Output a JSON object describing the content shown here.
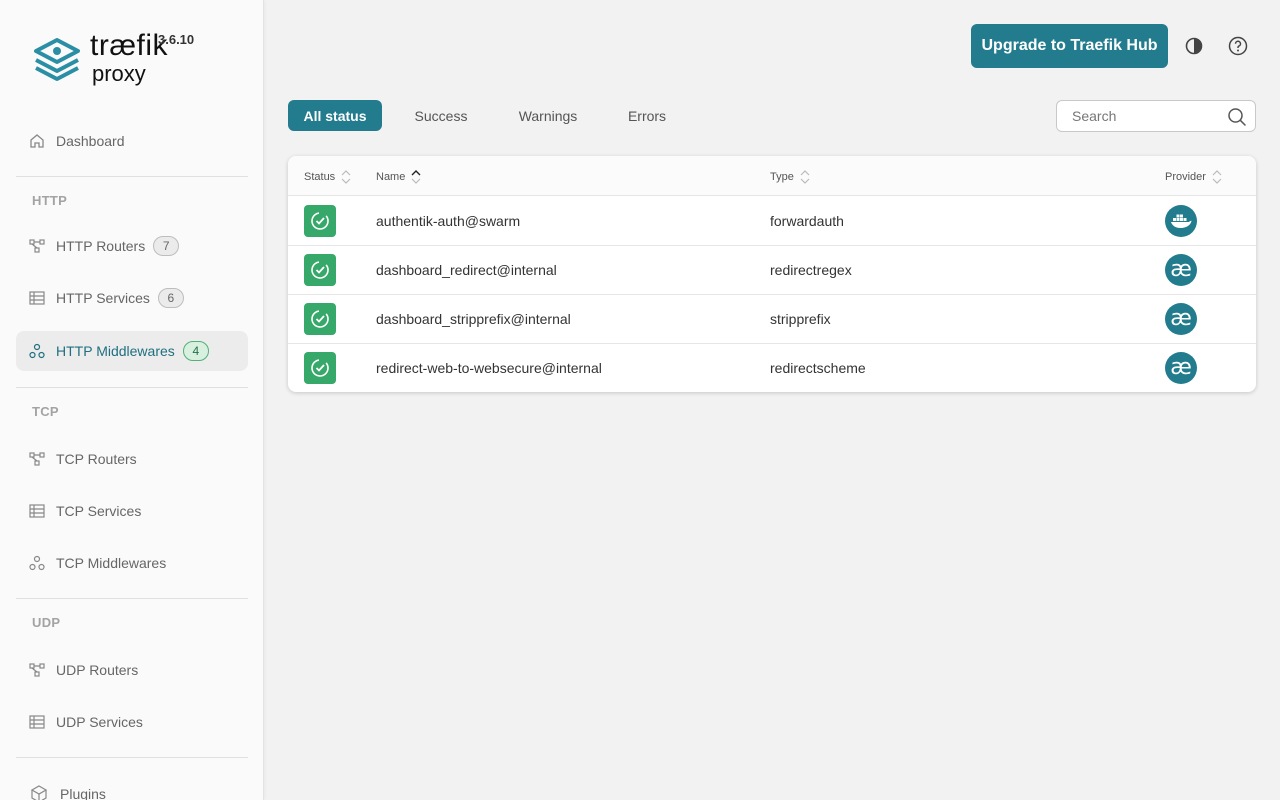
{
  "brand": {
    "name": "træfik",
    "sub": "proxy",
    "version": "3.6.10"
  },
  "sidebar": {
    "dashboard": "Dashboard",
    "sections": {
      "http": "HTTP",
      "tcp": "TCP",
      "udp": "UDP"
    },
    "items": [
      {
        "label": "HTTP Routers",
        "count": "7",
        "icon": "router-icon"
      },
      {
        "label": "HTTP Services",
        "count": "6",
        "icon": "services-icon"
      },
      {
        "label": "HTTP Middlewares",
        "count": "4",
        "icon": "middleware-icon",
        "active": true
      },
      {
        "label": "TCP Routers",
        "icon": "router-icon"
      },
      {
        "label": "TCP Services",
        "icon": "services-icon"
      },
      {
        "label": "TCP Middlewares",
        "icon": "middleware-icon"
      },
      {
        "label": "UDP Routers",
        "icon": "router-icon"
      },
      {
        "label": "UDP Services",
        "icon": "services-icon"
      },
      {
        "label": "Plugins",
        "icon": "plugins-icon"
      }
    ]
  },
  "header": {
    "upgrade_label": "Upgrade to Traefik Hub",
    "theme_icon": "contrast-icon",
    "help_icon": "help-icon"
  },
  "filters": {
    "all": "All status",
    "success": "Success",
    "warnings": "Warnings",
    "errors": "Errors"
  },
  "search": {
    "placeholder": "Search",
    "value": ""
  },
  "table": {
    "columns": {
      "status": "Status",
      "name": "Name",
      "type": "Type",
      "provider": "Provider"
    },
    "rows": [
      {
        "status": "success",
        "name": "authentik-auth@swarm",
        "type": "forwardauth",
        "provider": "docker"
      },
      {
        "status": "success",
        "name": "dashboard_redirect@internal",
        "type": "redirectregex",
        "provider": "internal"
      },
      {
        "status": "success",
        "name": "dashboard_stripprefix@internal",
        "type": "stripprefix",
        "provider": "internal"
      },
      {
        "status": "success",
        "name": "redirect-web-to-websecure@internal",
        "type": "redirectscheme",
        "provider": "internal"
      }
    ]
  },
  "colors": {
    "accent": "#227c8e",
    "success": "#36a86a"
  }
}
